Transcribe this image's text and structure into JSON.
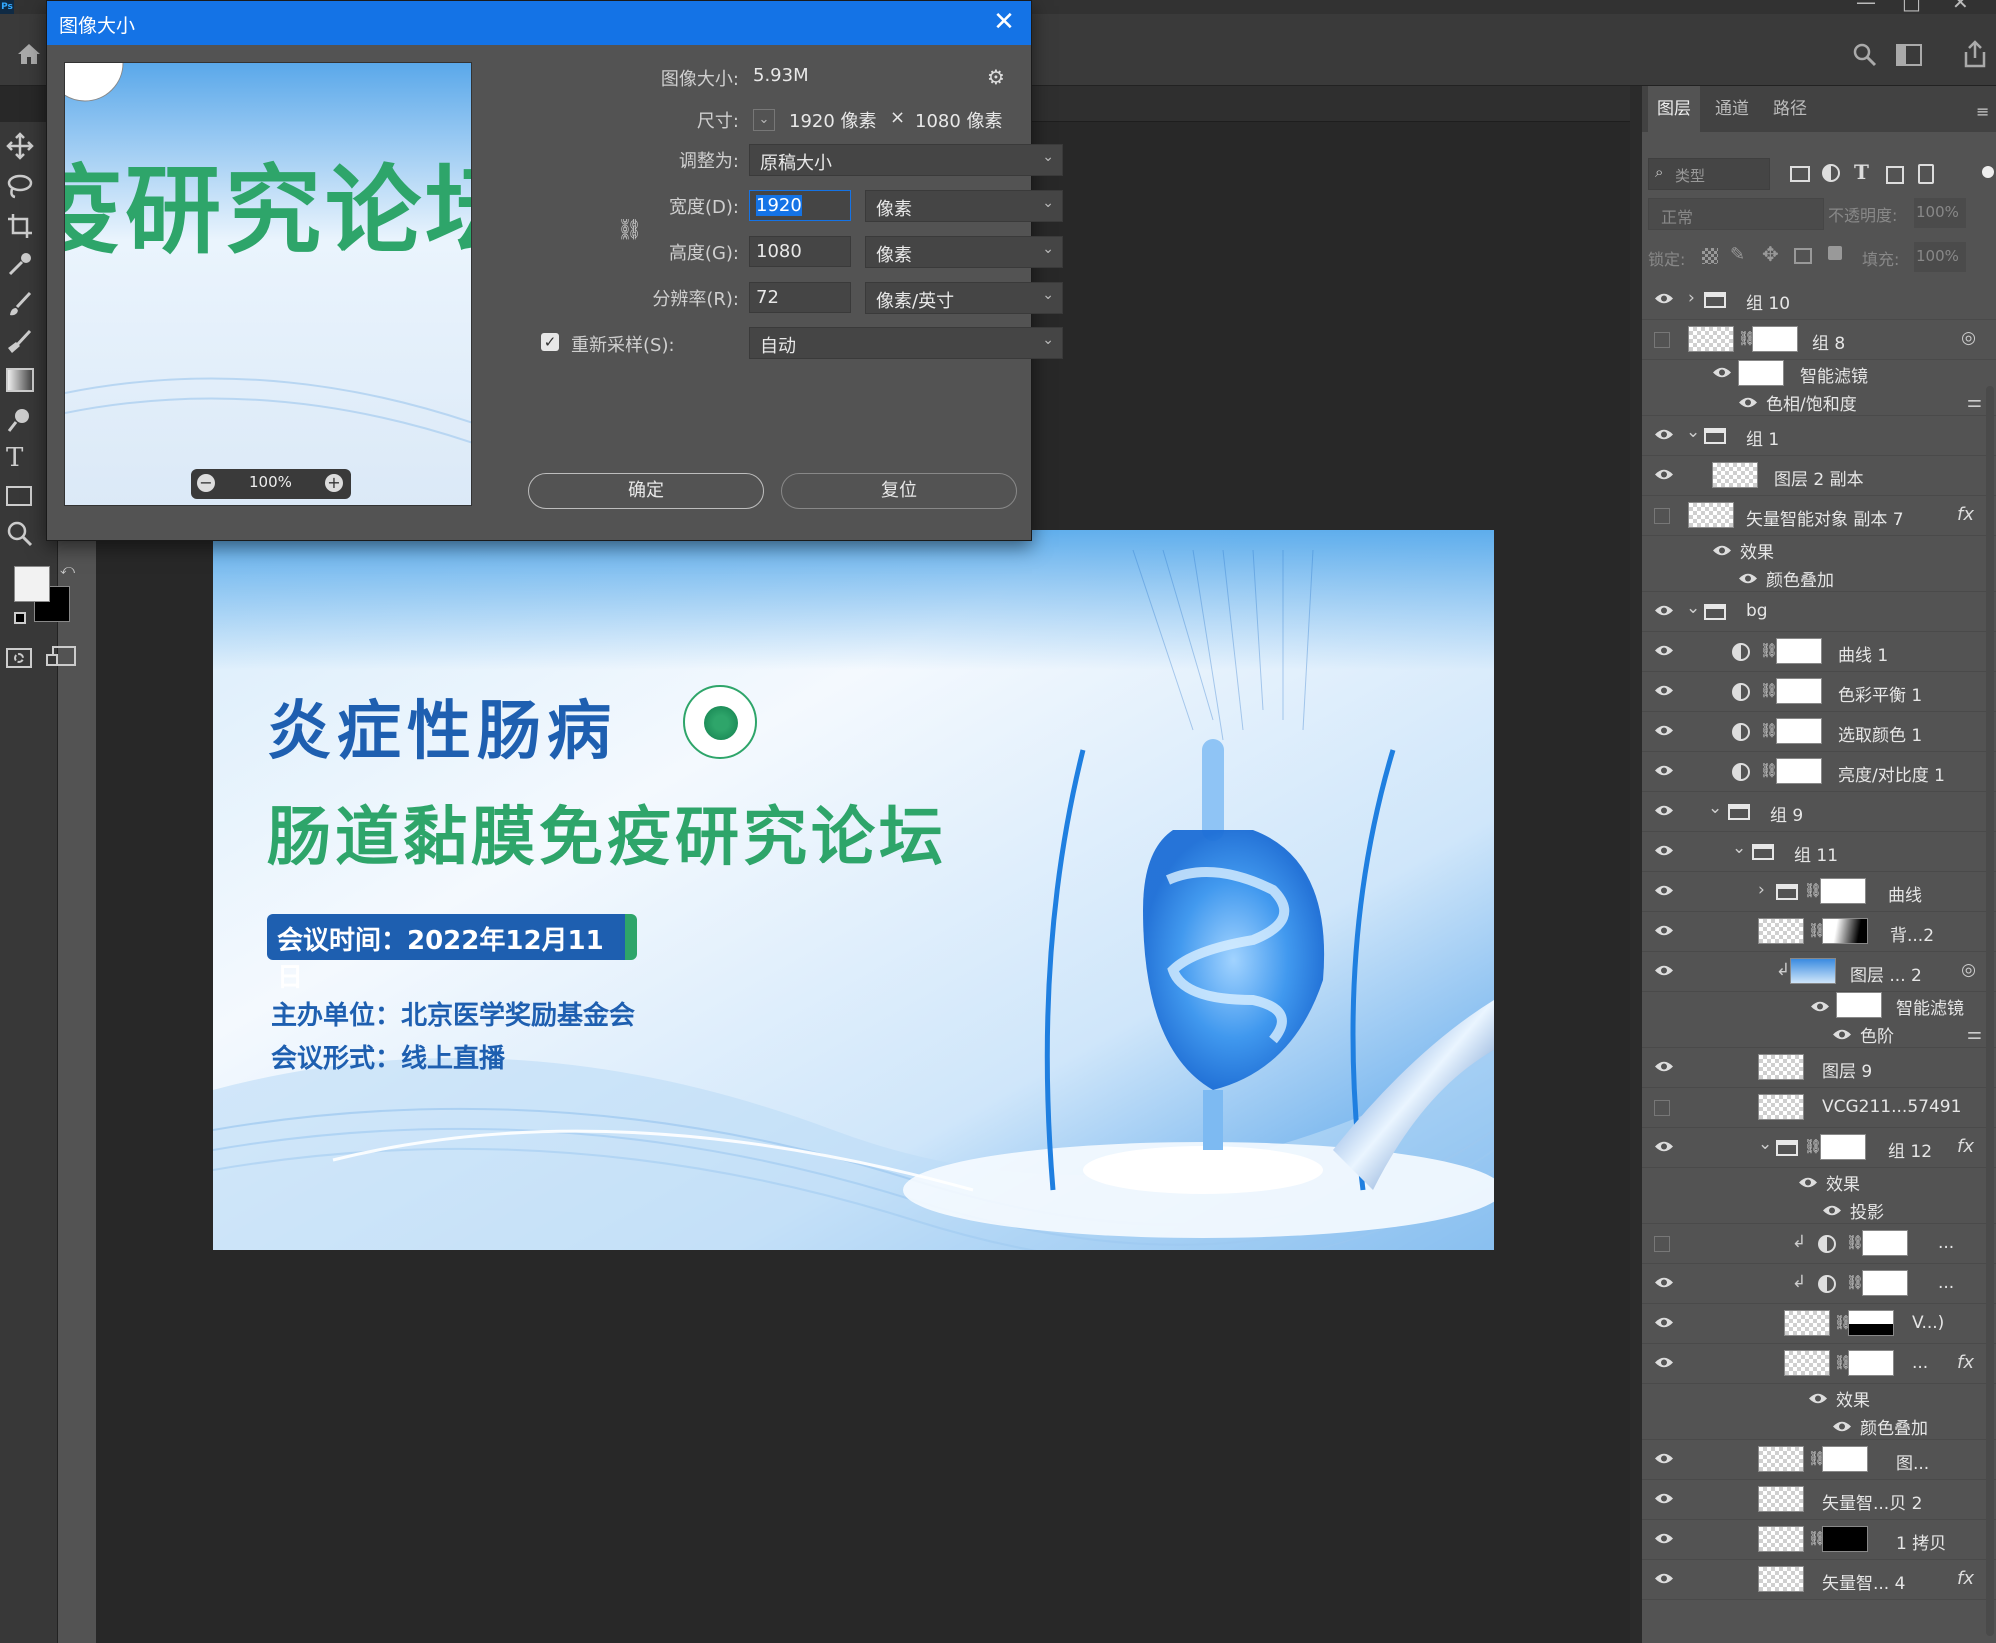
{
  "app": {
    "logo": "Ps"
  },
  "dialog": {
    "title": "图像大小",
    "image_size_label": "图像大小:",
    "image_size_value": "5.93M",
    "dimensions_label": "尺寸:",
    "dimensions_w": "1920 像素",
    "dimensions_x": "×",
    "dimensions_h": "1080 像素",
    "fit_label": "调整为:",
    "fit_value": "原稿大小",
    "width_label": "宽度(D):",
    "width_value": "1920",
    "width_unit": "像素",
    "height_label": "高度(G):",
    "height_value": "1080",
    "height_unit": "像素",
    "resolution_label": "分辨率(R):",
    "resolution_value": "72",
    "resolution_unit": "像素/英寸",
    "resample_label": "重新采样(S):",
    "resample_value": "自动",
    "zoom": "100%",
    "ok_label": "确定",
    "reset_label": "复位",
    "preview_text": "疫研究论坛"
  },
  "banner": {
    "title1": "炎症性肠病",
    "title2": "肠道黏膜免疫研究论坛",
    "date": "会议时间：2022年12月11日",
    "host": "主办单位：北京医学奖励基金会",
    "format": "会议形式：线上直播",
    "colors": {
      "blue": "#1e5fb0",
      "green": "#2ea56a",
      "sky": "#5aa8ea"
    }
  },
  "panel": {
    "tabs": [
      "图层",
      "通道",
      "路径"
    ],
    "filter_placeholder": "类型",
    "blend_mode": "正常",
    "opacity_label": "不透明度:",
    "opacity_value": "100%",
    "lock_label": "锁定:",
    "fill_label": "填充:",
    "fill_value": "100%",
    "layers": [
      {
        "name": "组 10"
      },
      {
        "name": "组 8"
      },
      {
        "name": "智能滤镜"
      },
      {
        "name": "色相/饱和度"
      },
      {
        "name": "组 1"
      },
      {
        "name": "图层 2 副本"
      },
      {
        "name": "矢量智能对象 副本 7"
      },
      {
        "name": "效果"
      },
      {
        "name": "颜色叠加"
      },
      {
        "name": "bg"
      },
      {
        "name": "曲线 1"
      },
      {
        "name": "色彩平衡 1"
      },
      {
        "name": "选取颜色 1"
      },
      {
        "name": "亮度/对比度 1"
      },
      {
        "name": "组 9"
      },
      {
        "name": "组 11"
      },
      {
        "name": "曲线"
      },
      {
        "name": "背...2"
      },
      {
        "name": "图层 ... 2"
      },
      {
        "name": "智能滤镜"
      },
      {
        "name": "色阶"
      },
      {
        "name": "图层 9"
      },
      {
        "name": "VCG211...57491"
      },
      {
        "name": "组 12"
      },
      {
        "name": "效果"
      },
      {
        "name": "投影"
      },
      {
        "name": "..."
      },
      {
        "name": "..."
      },
      {
        "name": "V...)"
      },
      {
        "name": "..."
      },
      {
        "name": "效果"
      },
      {
        "name": "颜色叠加"
      },
      {
        "name": "图..."
      },
      {
        "name": "矢量智...贝 2"
      },
      {
        "name": "1 拷贝"
      },
      {
        "name": "矢量智... 4"
      }
    ],
    "fx": "fx"
  }
}
